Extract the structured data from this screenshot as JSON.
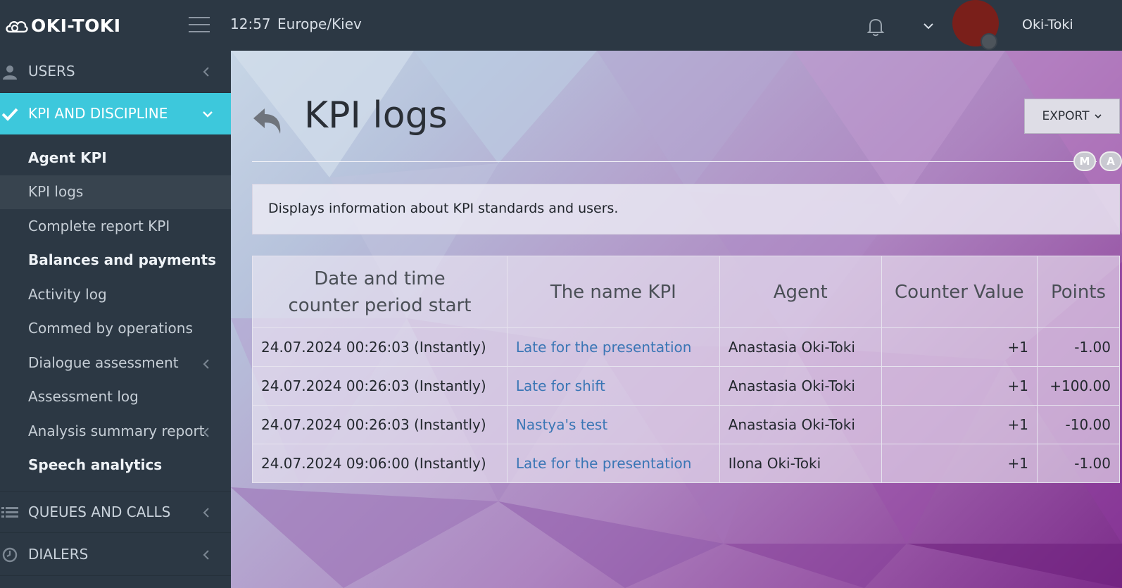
{
  "header": {
    "logo_text": "OKI-TOKI",
    "time": "12:57",
    "timezone": "Europe/Kiev",
    "username": "Oki-Toki",
    "avatar_color": "#7a1f1a"
  },
  "sidebar": {
    "sections": [
      {
        "label": "USERS",
        "icon": "user-icon"
      },
      {
        "label": "KPI AND DISCIPLINE",
        "icon": "check-icon",
        "active": true
      },
      {
        "label": "QUEUES AND CALLS",
        "icon": "list-icon"
      },
      {
        "label": "DIALERS",
        "icon": "clock-icon"
      }
    ],
    "items": [
      {
        "label": "Agent KPI",
        "bold": true
      },
      {
        "label": "KPI logs",
        "selected": true
      },
      {
        "label": "Complete report KPI"
      },
      {
        "label": "Balances and payments",
        "bold": true
      },
      {
        "label": "Activity log"
      },
      {
        "label": "Commed by operations"
      },
      {
        "label": "Dialogue assessment",
        "has_submenu": true
      },
      {
        "label": "Assessment log"
      },
      {
        "label": "Analysis summary report",
        "has_submenu": true
      },
      {
        "label": "Speech analytics",
        "bold": true
      }
    ],
    "active_color": "#3dc8dc"
  },
  "main": {
    "title": "KPI logs",
    "export_label": "EXPORT",
    "badges": [
      "M",
      "A"
    ],
    "info_text": "Displays information about KPI standards and users.",
    "table": {
      "headers": {
        "date_line1": "Date and time",
        "date_line2": "counter period start",
        "name": "The name KPI",
        "agent": "Agent",
        "counter": "Counter Value",
        "points": "Points"
      },
      "rows": [
        {
          "date": "24.07.2024 00:26:03 (Instantly)",
          "name": "Late for the presentation",
          "agent": "Anastasia Oki-Toki",
          "counter": "+1",
          "points": "-1.00"
        },
        {
          "date": "24.07.2024 00:26:03 (Instantly)",
          "name": "Late for shift",
          "agent": "Anastasia Oki-Toki",
          "counter": "+1",
          "points": "+100.00"
        },
        {
          "date": "24.07.2024 00:26:03 (Instantly)",
          "name": "Nastya's test",
          "agent": "Anastasia Oki-Toki",
          "counter": "+1",
          "points": "-10.00"
        },
        {
          "date": "24.07.2024 09:06:00 (Instantly)",
          "name": "Late for the presentation",
          "agent": "Ilona Oki-Toki",
          "counter": "+1",
          "points": "-1.00"
        }
      ]
    },
    "link_color": "#3a76b5"
  }
}
